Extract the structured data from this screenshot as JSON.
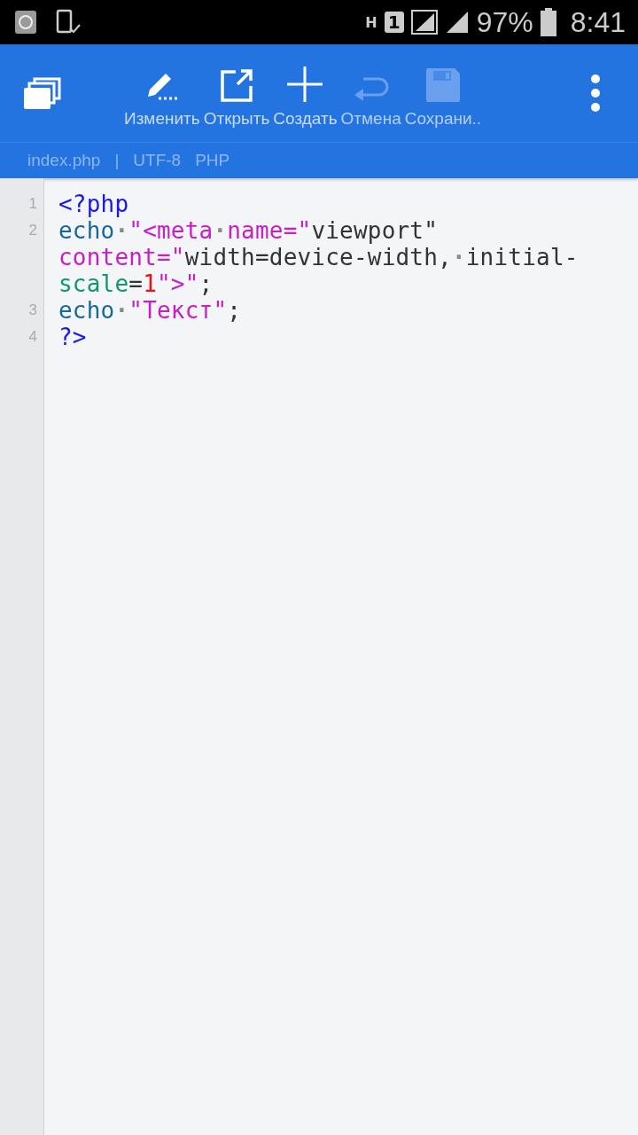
{
  "status_bar": {
    "network_type": "H",
    "sim": "1",
    "battery": "97%",
    "time": "8:41"
  },
  "toolbar": {
    "actions": [
      {
        "kind": "edit",
        "label": "Изменить",
        "disabled": false
      },
      {
        "kind": "open",
        "label": "Открыть",
        "disabled": false
      },
      {
        "kind": "create",
        "label": "Создать",
        "disabled": false
      },
      {
        "kind": "undo",
        "label": "Отмена",
        "disabled": true
      },
      {
        "kind": "save",
        "label": "Сохрани..",
        "disabled": true
      }
    ]
  },
  "file_info": {
    "filename": "index.php",
    "separator": "|",
    "encoding": "UTF-8",
    "language": "PHP"
  },
  "editor": {
    "lines": [
      {
        "number": "1",
        "rows": [
          {
            "tokens": [
              {
                "kind": "tag",
                "text": "<?php"
              }
            ]
          }
        ]
      },
      {
        "number": "2",
        "rows": [
          {
            "tokens": [
              {
                "kind": "keyword",
                "text": "echo"
              },
              {
                "kind": "space",
                "text": "·"
              },
              {
                "kind": "string",
                "text": "\"<meta"
              },
              {
                "kind": "space",
                "text": "·"
              },
              {
                "kind": "string",
                "text": "name=\""
              },
              {
                "kind": "plain",
                "text": "viewport\""
              }
            ]
          },
          {
            "tokens": [
              {
                "kind": "string",
                "text": "content=\""
              },
              {
                "kind": "plain",
                "text": "width=device-width,"
              },
              {
                "kind": "space",
                "text": "·"
              },
              {
                "kind": "plain",
                "text": "initial-"
              }
            ]
          },
          {
            "tokens": [
              {
                "kind": "attr",
                "text": "scale"
              },
              {
                "kind": "plain",
                "text": "="
              },
              {
                "kind": "number",
                "text": "1"
              },
              {
                "kind": "string",
                "text": "\">\""
              },
              {
                "kind": "plain",
                "text": ";"
              }
            ]
          }
        ]
      },
      {
        "number": "3",
        "rows": [
          {
            "tokens": [
              {
                "kind": "keyword",
                "text": "echo"
              },
              {
                "kind": "space",
                "text": "·"
              },
              {
                "kind": "string",
                "text": "\"Текст\""
              },
              {
                "kind": "plain",
                "text": ";"
              }
            ]
          }
        ]
      },
      {
        "number": "4",
        "rows": [
          {
            "tokens": [
              {
                "kind": "tag",
                "text": "?>"
              }
            ]
          }
        ]
      }
    ]
  }
}
